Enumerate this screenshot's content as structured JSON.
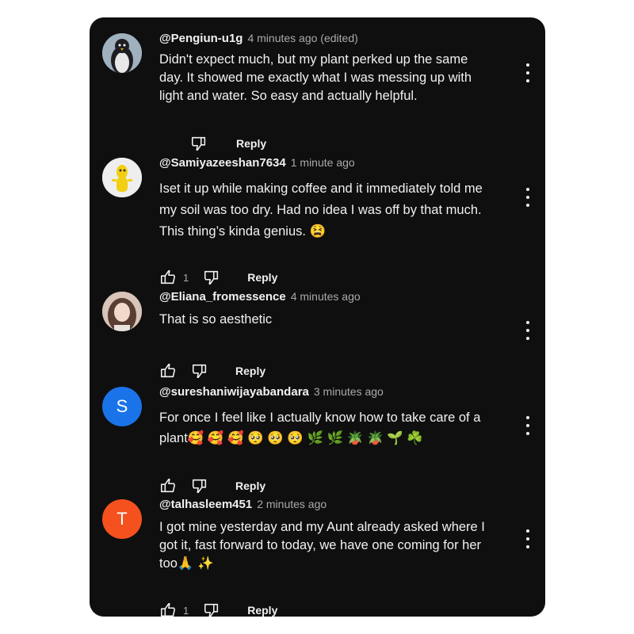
{
  "comments": [
    {
      "handle": "@Pengiun-u1g",
      "time": "4 minutes ago (edited)",
      "lines": [
        "Didn't expect much, but my plant perked up the same",
        "day. It showed me exactly what I was messing up with",
        "light and water. So easy and actually helpful."
      ],
      "like_count": "",
      "reply_label": "Reply",
      "avatar": "penguin"
    },
    {
      "handle": "@Samiyazeeshan7634",
      "time": "1 minute ago",
      "lines": [
        "Iset it up while making coffee and it immediately told me",
        "my soil was too dry. Had no idea I was off by that much.",
        "This thing’s kinda genius. 😫"
      ],
      "like_count": "1",
      "reply_label": "Reply",
      "avatar": "yellow-figure"
    },
    {
      "handle": "@Eliana_fromessence",
      "time": "4 minutes ago",
      "lines": [
        "That is so aesthetic"
      ],
      "like_count": "",
      "reply_label": "Reply",
      "avatar": "photo"
    },
    {
      "handle": "@sureshaniwijayabandara",
      "time": "3 minutes ago",
      "lines": [
        "For once I feel like I actually know how to take care of a",
        "plant🥰 🥰 🥰 🥺 🥺 🥺 🌿 🌿 🪴 🪴 🌱 ☘️"
      ],
      "like_count": "",
      "reply_label": "Reply",
      "avatar_letter": "S",
      "avatar_color": "#1a73e8"
    },
    {
      "handle": "@talhasleem451",
      "time": "2 minutes ago",
      "lines": [
        "I got mine yesterday and my Aunt already asked where I",
        "got it, fast forward to today, we have one coming for her",
        "too🙏 ✨"
      ],
      "like_count": "1",
      "reply_label": "Reply",
      "avatar_letter": "T",
      "avatar_color": "#f4511e"
    }
  ],
  "icons": {
    "like": "thumbs-up-icon",
    "dislike": "thumbs-down-icon",
    "more": "more-vert-icon"
  },
  "colors": {
    "panel_bg": "#0f0f0f",
    "primary_text": "#f1f1f1",
    "secondary_text": "#aaaaaa"
  }
}
